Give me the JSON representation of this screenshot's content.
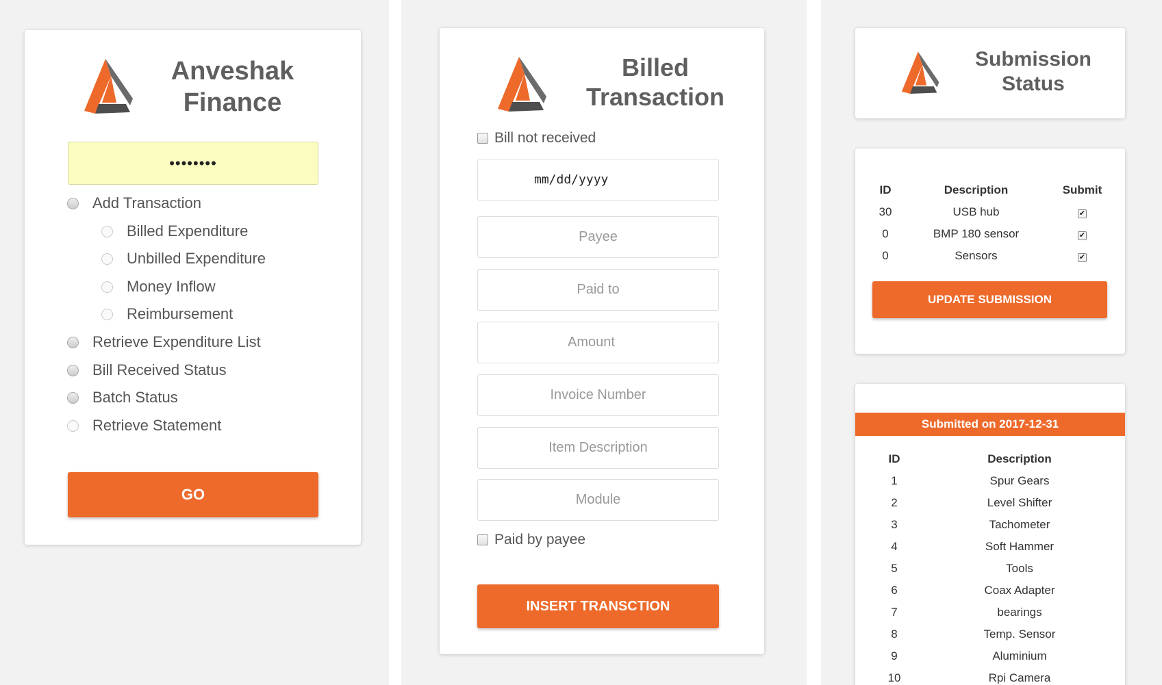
{
  "login": {
    "title_line1": "Anveshak",
    "title_line2": "Finance",
    "password_value": "••••••••",
    "options": [
      {
        "label": "Add Transaction",
        "level": 0
      },
      {
        "label": "Billed Expenditure",
        "level": 1
      },
      {
        "label": "Unbilled Expenditure",
        "level": 1
      },
      {
        "label": "Money Inflow",
        "level": 1
      },
      {
        "label": "Reimbursement",
        "level": 1
      },
      {
        "label": "Retrieve Expenditure List",
        "level": 0
      },
      {
        "label": "Bill Received Status",
        "level": 0
      },
      {
        "label": "Batch Status",
        "level": 0
      },
      {
        "label": "Retrieve Statement",
        "level": 0
      }
    ],
    "go_label": "GO"
  },
  "billed": {
    "title_line1": "Billed",
    "title_line2": "Transaction",
    "bill_not_received_label": "Bill not received",
    "date_placeholder": "mm/dd/yyyy",
    "payee_placeholder": "Payee",
    "paid_to_placeholder": "Paid to",
    "amount_placeholder": "Amount",
    "invoice_placeholder": "Invoice Number",
    "item_desc_placeholder": "Item Description",
    "module_placeholder": "Module",
    "paid_by_payee_label": "Paid by payee",
    "insert_label": "INSERT TRANSCTION"
  },
  "submission": {
    "title_line1": "Submission",
    "title_line2": "Status",
    "headers": {
      "id": "ID",
      "description": "Description",
      "submit": "Submit"
    },
    "rows": [
      {
        "id": "30",
        "description": "USB hub",
        "checked": true
      },
      {
        "id": "0",
        "description": "BMP 180 sensor",
        "checked": true
      },
      {
        "id": "0",
        "description": "Sensors",
        "checked": true
      }
    ],
    "update_label": "UPDATE SUBMISSION",
    "submitted_banner": "Submitted on 2017-12-31",
    "submitted_headers": {
      "id": "ID",
      "description": "Description"
    },
    "submitted_rows": [
      {
        "id": "1",
        "description": "Spur Gears"
      },
      {
        "id": "2",
        "description": "Level Shifter"
      },
      {
        "id": "3",
        "description": "Tachometer"
      },
      {
        "id": "4",
        "description": "Soft Hammer"
      },
      {
        "id": "5",
        "description": "Tools"
      },
      {
        "id": "6",
        "description": "Coax Adapter"
      },
      {
        "id": "7",
        "description": "bearings"
      },
      {
        "id": "8",
        "description": "Temp. Sensor"
      },
      {
        "id": "9",
        "description": "Aluminium"
      },
      {
        "id": "10",
        "description": "Rpi Camera"
      }
    ]
  },
  "colors": {
    "accent": "#ee6a2b",
    "logo_dark": "#5a5a5a",
    "password_bg": "#fafcc0"
  }
}
